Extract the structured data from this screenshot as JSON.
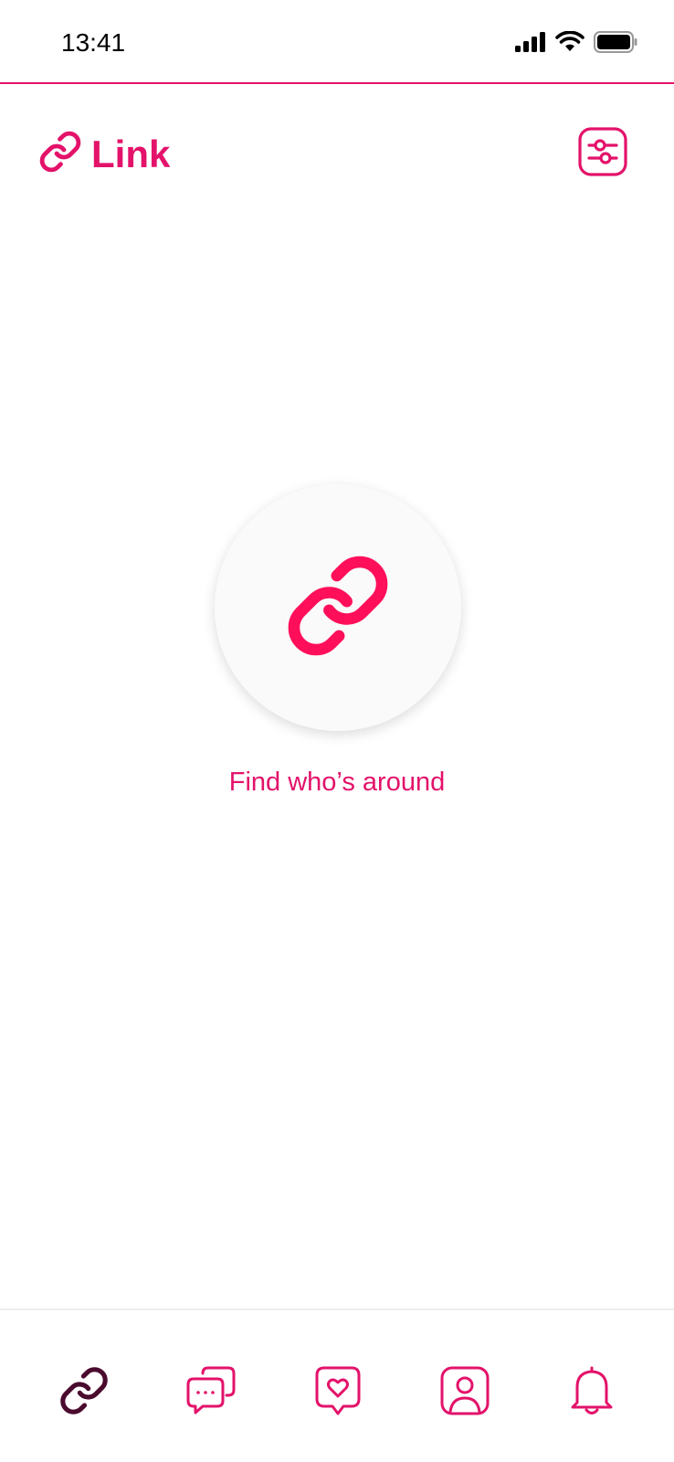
{
  "status_bar": {
    "time": "13:41",
    "icons": [
      "signal-icon",
      "wifi-icon",
      "battery-icon"
    ]
  },
  "header": {
    "title": "Link",
    "logo_icon": "link-icon",
    "filter_icon": "filter-sliders-icon"
  },
  "main": {
    "center_icon": "link-icon",
    "cta_text": "Find who’s around"
  },
  "bottom_nav": {
    "items": [
      {
        "icon": "link-icon",
        "active": true
      },
      {
        "icon": "chat-bubbles-icon",
        "active": false
      },
      {
        "icon": "heart-message-icon",
        "active": false
      },
      {
        "icon": "profile-icon",
        "active": false
      },
      {
        "icon": "bell-icon",
        "active": false
      }
    ]
  },
  "colors": {
    "accent": "#E3126A",
    "active_nav": "#4A0B2E",
    "background": "#FFFFFF",
    "circle_bg": "#FAFAFA"
  }
}
